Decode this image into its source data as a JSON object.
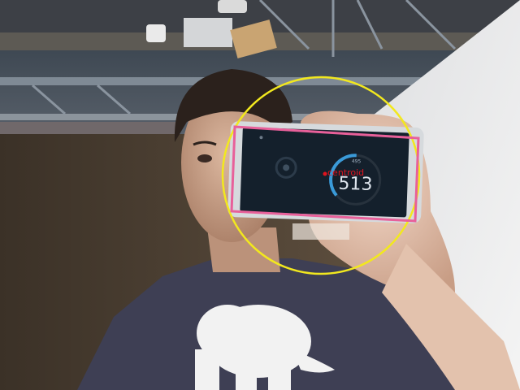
{
  "overlay": {
    "centroid_label": "centroid",
    "circle_color": "#f2e81e",
    "box_color": "#e8609a",
    "point_color": "#e0141e"
  },
  "phone_screen": {
    "big_number": "513",
    "small_top_label": "495",
    "accent_color": "#3a9ad8"
  },
  "shirt": {
    "print": "elephant-graphic"
  }
}
